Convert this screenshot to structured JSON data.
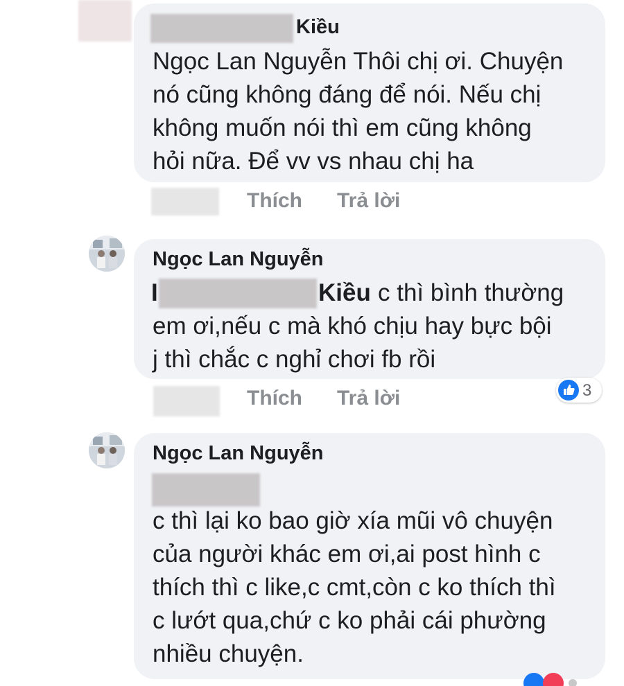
{
  "comments": [
    {
      "author_suffix": "Kiều",
      "lines": [
        "Ngọc Lan Nguyễn Thôi chị ơi. Chuyện",
        "nó cũng không đáng để nói. Nếu chị",
        "không muốn nói thì em cũng không",
        "hỏi nữa. Để vv vs nhau chị ha"
      ],
      "actions": {
        "like": "Thích",
        "reply": "Trả lời"
      }
    },
    {
      "author": "Ngọc Lan Nguyễn",
      "mention_prefix": "I",
      "mention_suffix": "Kiều",
      "first_line_rest": "c thì bình thường",
      "lines": [
        "em ơi,nếu c mà khó chịu hay bực bội",
        "j thì chắc c nghỉ chơi fb rồi"
      ],
      "reactions": {
        "icon": "like-reaction-icon",
        "count": "3",
        "color": "#1877f2"
      },
      "actions": {
        "like": "Thích",
        "reply": "Trả lời"
      }
    },
    {
      "author": "Ngọc Lan Nguyễn",
      "lines": [
        "c thì lại ko bao giờ xía mũi vô chuyện",
        "của người khác em ơi,ai post hình c",
        "thích thì c like,c cmt,còn c ko thích thì",
        "c lướt qua,chứ c ko phải cái phường",
        "nhiều chuyện."
      ]
    }
  ],
  "colors": {
    "bubble": "#f0f2f5",
    "action_text": "#8a8d91",
    "like_blue": "#1877f2",
    "love_red": "#f33e58"
  }
}
